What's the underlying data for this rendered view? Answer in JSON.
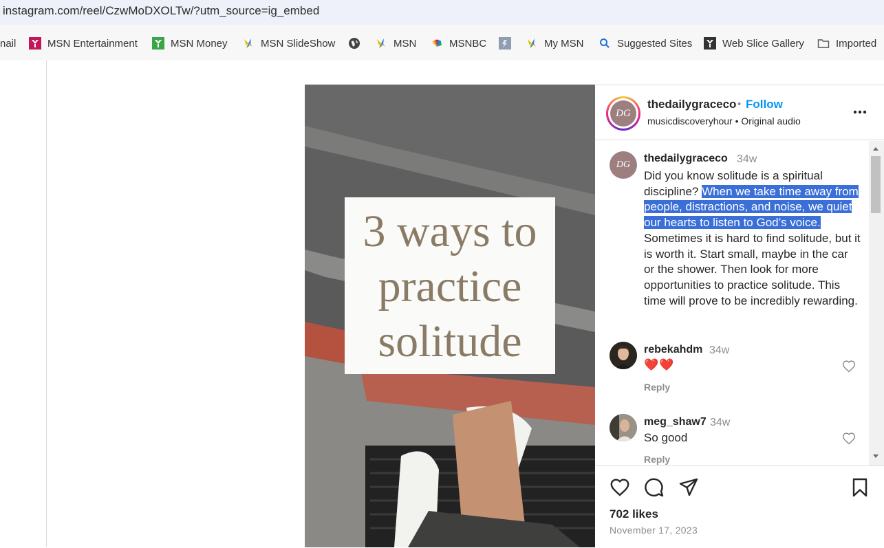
{
  "browser": {
    "url": "instagram.com/reel/CzwMoDXOLTw/?utm_source=ig_embed",
    "favorites": [
      {
        "label": "nail",
        "icon": "none"
      },
      {
        "label": "MSN Entertainment",
        "icon": "msn-entertainment-icon"
      },
      {
        "label": "MSN Money",
        "icon": "msn-money-icon"
      },
      {
        "label": "MSN SlideShow",
        "icon": "msn-butterfly-icon"
      },
      {
        "label": "",
        "icon": "globe-icon"
      },
      {
        "label": "MSN",
        "icon": "msn-butterfly-icon"
      },
      {
        "label": "MSNBC",
        "icon": "peacock-icon"
      },
      {
        "label": "",
        "icon": "web-slice-thumbnail-icon"
      },
      {
        "label": "My MSN",
        "icon": "msn-butterfly-icon"
      },
      {
        "label": "Suggested Sites",
        "icon": "search-icon"
      },
      {
        "label": "Web Slice Gallery",
        "icon": "web-slice-gallery-icon"
      },
      {
        "label": "Imported",
        "icon": "folder-icon"
      }
    ]
  },
  "reel": {
    "overlay_lines": [
      "3 ways to",
      "practice",
      "solitude"
    ]
  },
  "post": {
    "username": "thedailygraceco",
    "dot": "•",
    "follow_label": "Follow",
    "subtitle": "musicdiscoveryhour • Original audio",
    "avatar_initials": "DG",
    "caption": {
      "username": "thedailygraceco",
      "time": "34w",
      "text_before": "Did you know solitude is a spiritual discipline? ",
      "text_highlighted": "When we take time away from people, distractions, and noise, we quiet our hearts to listen to God’s voice.",
      "text_after": " Sometimes it is hard to find solitude, but it is worth it. Start small, maybe in the car or the shower. Then look for more opportunities to practice solitude. This time will prove to be incredibly rewarding."
    },
    "comments": [
      {
        "username": "rebekahdm",
        "time": "34w",
        "text": "❤️❤️",
        "reply": "Reply"
      },
      {
        "username": "meg_shaw7",
        "time": "34w",
        "text": "So good",
        "reply": "Reply"
      }
    ],
    "likes": "702 likes",
    "date": "November 17, 2023"
  },
  "colors": {
    "follow_blue": "#0095f6",
    "selection_blue": "#3a6fd8",
    "heart_red": "#ed4956"
  }
}
